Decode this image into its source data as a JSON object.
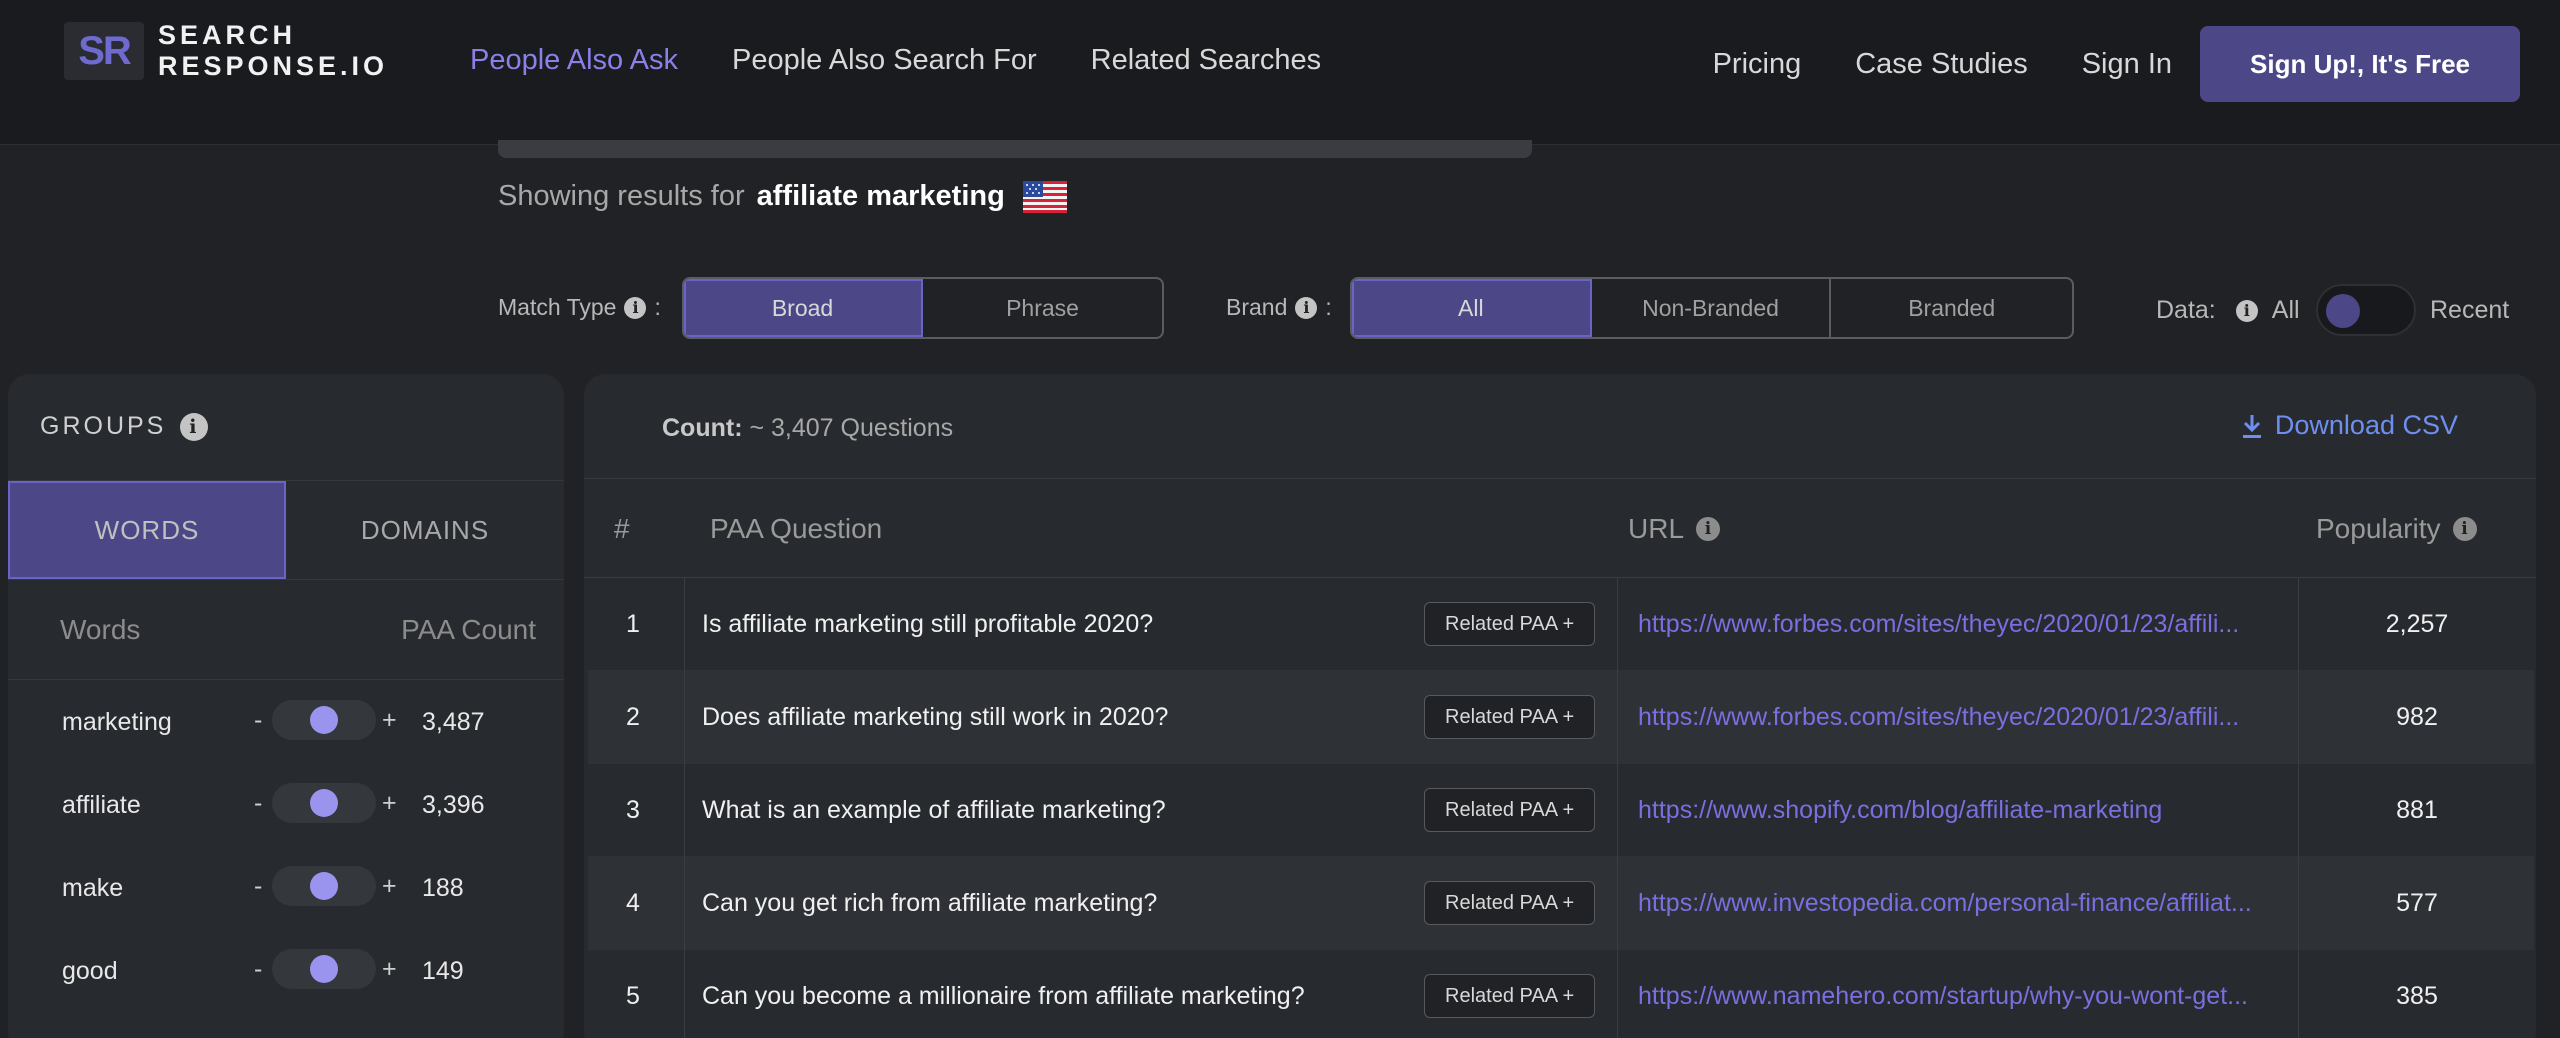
{
  "logo": {
    "mark": "SR",
    "line1": "SEARCH",
    "line2": "RESPONSE.IO"
  },
  "nav": {
    "people_also_ask": "People Also Ask",
    "people_also_search_for": "People Also Search For",
    "related_searches": "Related Searches",
    "pricing": "Pricing",
    "case_studies": "Case Studies",
    "sign_in": "Sign In",
    "signup": "Sign Up!, It's Free"
  },
  "showing": {
    "prefix": "Showing results for",
    "query": "affiliate marketing"
  },
  "filters": {
    "match_type": {
      "label": "Match Type",
      "options": [
        "Broad",
        "Phrase"
      ],
      "selected": "Broad"
    },
    "brand": {
      "label": "Brand",
      "options": [
        "All",
        "Non-Branded",
        "Branded"
      ],
      "selected": "All"
    },
    "data": {
      "label": "Data:",
      "left": "All",
      "right": "Recent",
      "value": "All"
    }
  },
  "groups": {
    "title": "GROUPS",
    "tabs": [
      "WORDS",
      "DOMAINS"
    ],
    "header": {
      "words": "Words",
      "count": "PAA Count"
    },
    "rows": [
      {
        "word": "marketing",
        "count": "3,487"
      },
      {
        "word": "affiliate",
        "count": "3,396"
      },
      {
        "word": "make",
        "count": "188"
      },
      {
        "word": "good",
        "count": "149"
      }
    ]
  },
  "results": {
    "count_label": "Count:",
    "count_value": "~ 3,407 Questions",
    "download": "Download CSV",
    "columns": {
      "num": "#",
      "question": "PAA Question",
      "url": "URL",
      "popularity": "Popularity"
    },
    "related_label": "Related PAA +",
    "rows": [
      {
        "n": "1",
        "q": "Is affiliate marketing still profitable 2020?",
        "url": "https://www.forbes.com/sites/theyec/2020/01/23/affili...",
        "pop": "2,257"
      },
      {
        "n": "2",
        "q": "Does affiliate marketing still work in 2020?",
        "url": "https://www.forbes.com/sites/theyec/2020/01/23/affili...",
        "pop": "982"
      },
      {
        "n": "3",
        "q": "What is an example of affiliate marketing?",
        "url": "https://www.shopify.com/blog/affiliate-marketing",
        "pop": "881"
      },
      {
        "n": "4",
        "q": "Can you get rich from affiliate marketing?",
        "url": "https://www.investopedia.com/personal-finance/affiliat...",
        "pop": "577"
      },
      {
        "n": "5",
        "q": "Can you become a millionaire from affiliate marketing?",
        "url": "https://www.namehero.com/startup/why-you-wont-get...",
        "pop": "385"
      }
    ]
  }
}
